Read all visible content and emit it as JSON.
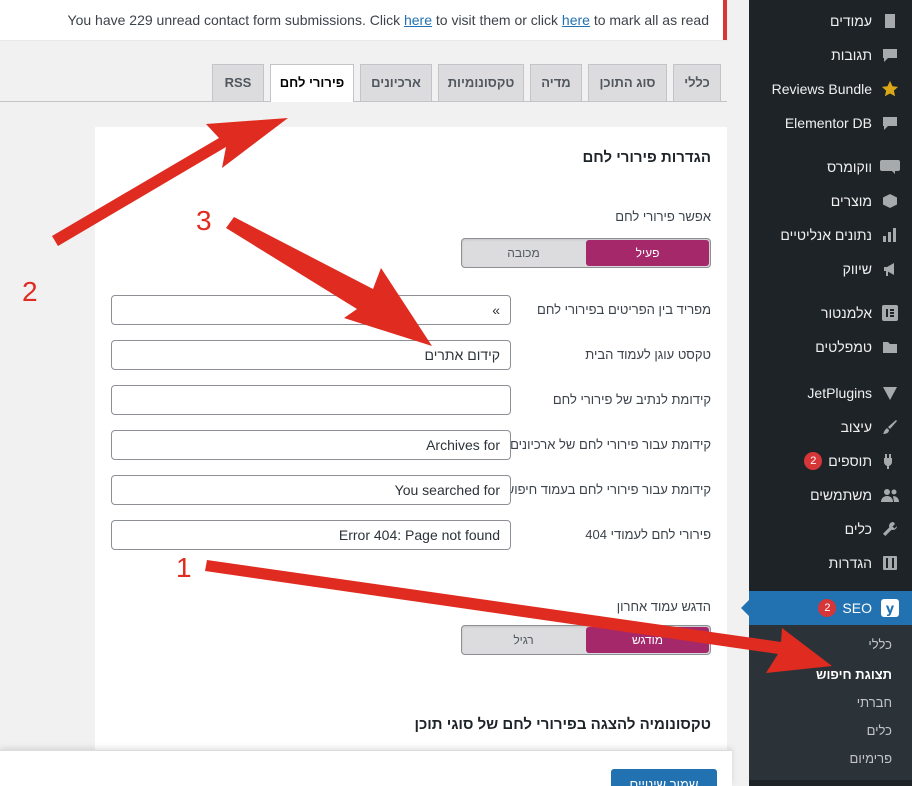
{
  "notice": {
    "prefix": "You have 229 unread contact form submissions. Click ",
    "link1": "here",
    "middle": " to visit them or click ",
    "link2": "here",
    "suffix": " to mark all as read"
  },
  "tabs": [
    {
      "label": "כללי"
    },
    {
      "label": "סוג התוכן"
    },
    {
      "label": "מדיה"
    },
    {
      "label": "טקסונומיות"
    },
    {
      "label": "ארכיונים"
    },
    {
      "label": "פירורי לחם",
      "active": true
    },
    {
      "label": "RSS"
    }
  ],
  "panel": {
    "title": "הגדרות פירורי לחם",
    "enable": {
      "label": "אפשר פירורי לחם",
      "on": "פעיל",
      "off": "מכובה"
    },
    "separator": {
      "label": "מפריד בין הפריטים בפירורי לחם",
      "value": "»"
    },
    "home_anchor": {
      "label": "טקסט עוגן לעמוד הבית",
      "value": "קידום אתרים"
    },
    "path_prefix": {
      "label": "קידומת לנתיב של פירורי לחם",
      "value": ""
    },
    "archive_prefix": {
      "label": "קידומת עבור פירורי לחם של ארכיונים",
      "value": "Archives for"
    },
    "search_prefix": {
      "label": "קידומת עבור פירורי לחם בעמוד חיפוש",
      "value": "You searched for"
    },
    "404": {
      "label": "פירורי לחם לעמודי 404",
      "value": "Error 404: Page not found"
    },
    "bold_last": {
      "label": "הדגש עמוד אחרון",
      "on": "מודגש",
      "off": "רגיל"
    },
    "taxonomy_title": "טקסונומיה להצגה בפירורי לחם של סוגי תוכן"
  },
  "save_button": "שמור שינויים",
  "sidebar": {
    "items": [
      {
        "label": "עמודים",
        "icon": "pages-icon"
      },
      {
        "label": "תגובות",
        "icon": "comments-icon"
      },
      {
        "label": "Reviews Bundle",
        "icon": "star-icon"
      },
      {
        "label": "Elementor DB",
        "icon": "comments-icon"
      },
      {
        "label": "ווקומרס",
        "icon": "woo-icon"
      },
      {
        "label": "מוצרים",
        "icon": "box-icon"
      },
      {
        "label": "נתונים אנליטיים",
        "icon": "chart-icon"
      },
      {
        "label": "שיווק",
        "icon": "megaphone-icon"
      },
      {
        "label": "אלמנטור",
        "icon": "elementor-icon"
      },
      {
        "label": "טמפלטים",
        "icon": "folder-icon"
      },
      {
        "label": "JetPlugins",
        "icon": "jet-icon"
      },
      {
        "label": "עיצוב",
        "icon": "brush-icon"
      },
      {
        "label": "תוספים",
        "icon": "plugin-icon",
        "badge": "2"
      },
      {
        "label": "משתמשים",
        "icon": "users-icon"
      },
      {
        "label": "כלים",
        "icon": "wrench-icon"
      },
      {
        "label": "הגדרות",
        "icon": "settings-icon"
      },
      {
        "label": "SEO",
        "icon": "yoast-icon",
        "badge": "2",
        "active": true
      }
    ],
    "submenu": [
      {
        "label": "כללי"
      },
      {
        "label": "תצוגת חיפוש",
        "current": true
      },
      {
        "label": "חברתי"
      },
      {
        "label": "כלים"
      },
      {
        "label": "פרימיום"
      }
    ]
  },
  "annotations": {
    "label_1": "1",
    "label_2": "2",
    "label_3": "3",
    "color": "#e02b20"
  },
  "colors": {
    "sidebar_bg": "#1d2327",
    "accent_blue": "#2271b1",
    "toggle_on": "#a4286a",
    "notice_border": "#d63638"
  }
}
